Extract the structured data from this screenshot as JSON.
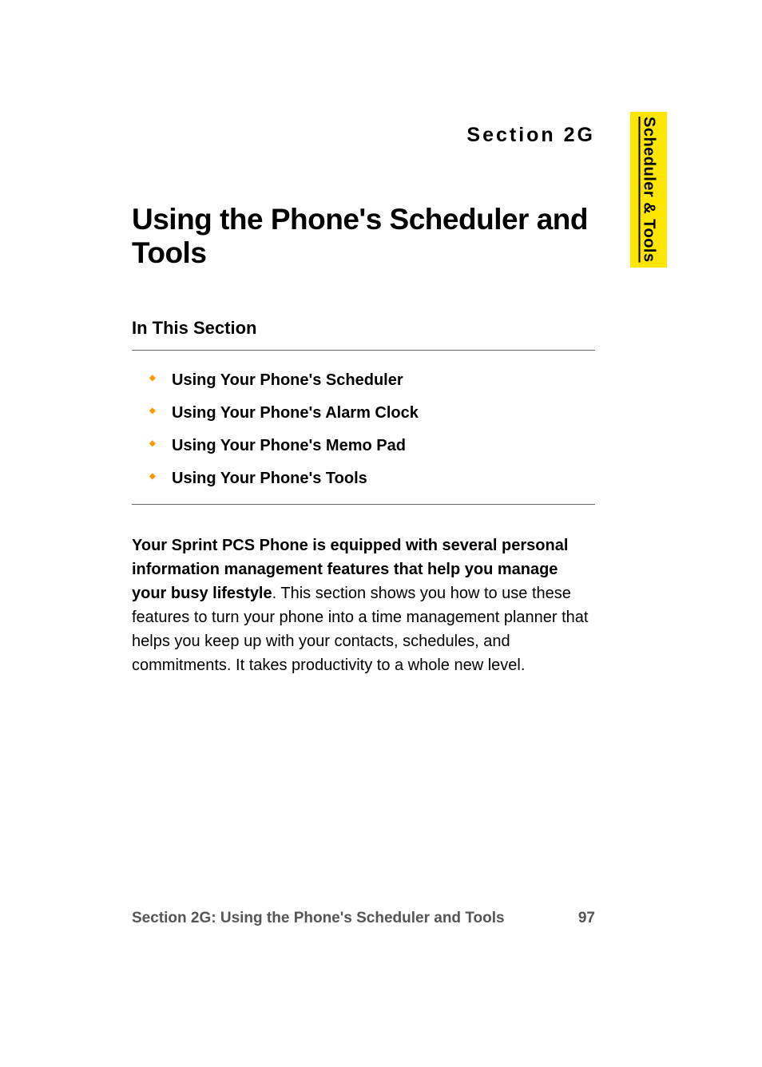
{
  "sideTab": {
    "label": "Scheduler & Tools"
  },
  "header": {
    "sectionLabel": "Section 2G",
    "title": "Using the Phone's Scheduler and Tools",
    "subtitle": "In This Section"
  },
  "bullets": [
    {
      "text": "Using Your Phone's Scheduler"
    },
    {
      "text": "Using Your Phone's Alarm Clock"
    },
    {
      "text": "Using Your Phone's Memo Pad"
    },
    {
      "text": "Using Your Phone's Tools"
    }
  ],
  "paragraph": {
    "boldPart": "Your Sprint PCS Phone is equipped with several personal information management features that help you manage your busy lifestyle",
    "rest": ". This section shows you how to use these features to turn your phone into a time management planner that helps you keep up with your contacts, schedules, and commitments. It takes productivity to a whole new level."
  },
  "footer": {
    "text": "Section 2G: Using the Phone's Scheduler and Tools",
    "pageNumber": "97"
  }
}
